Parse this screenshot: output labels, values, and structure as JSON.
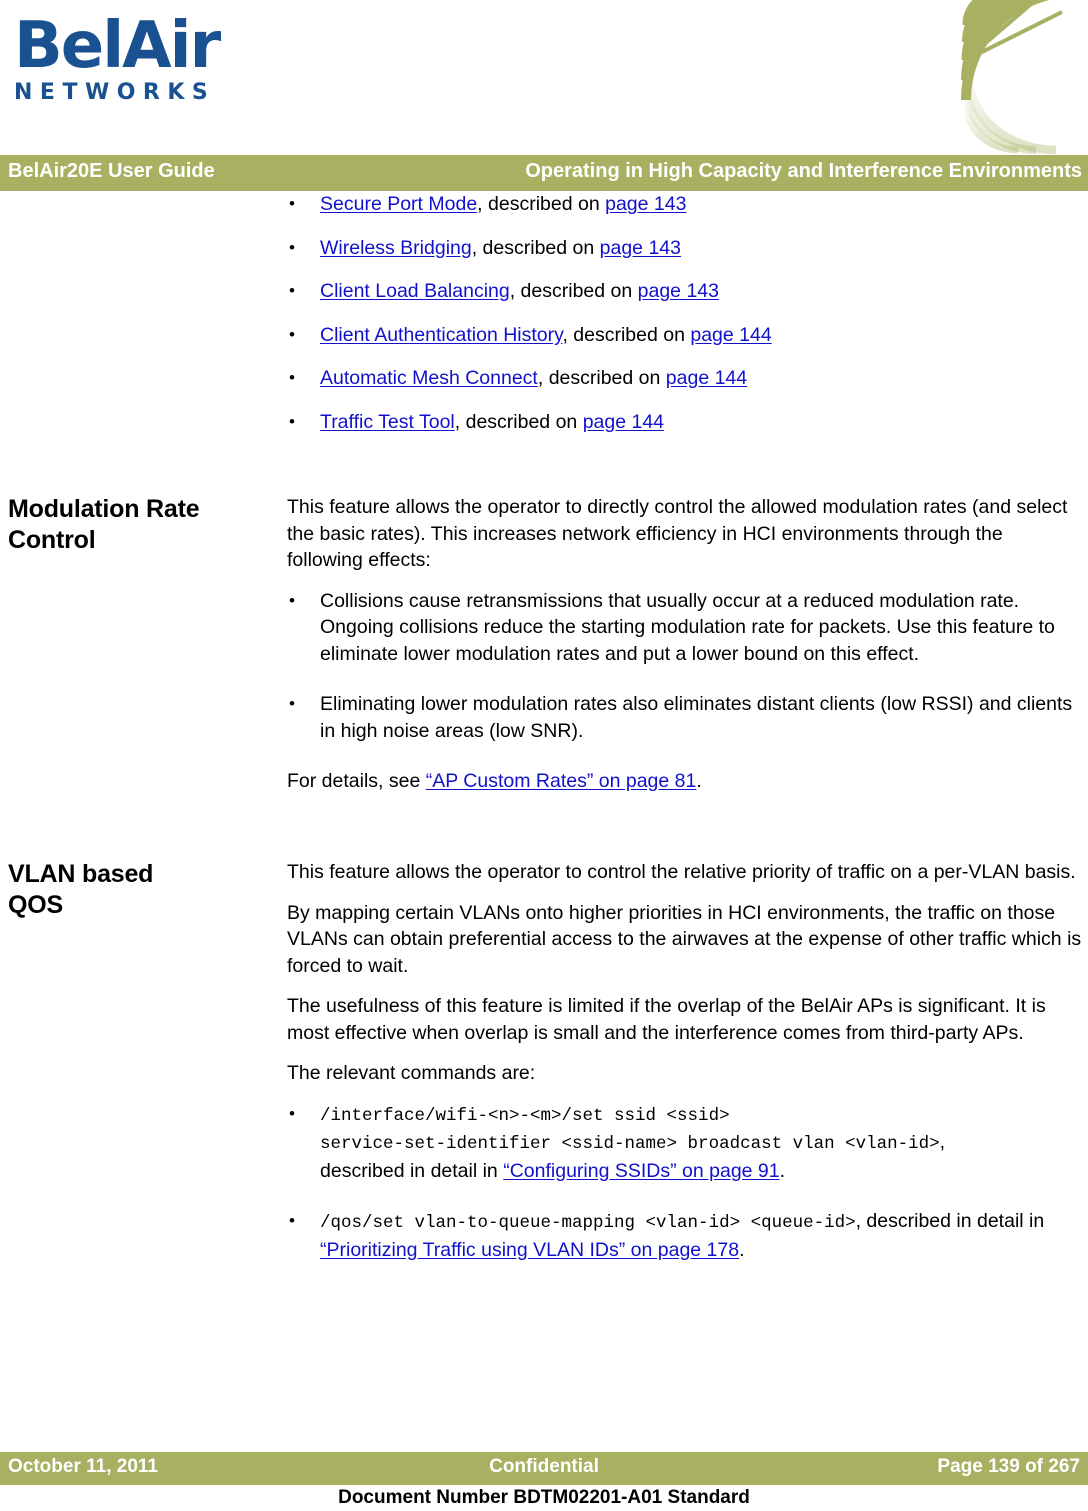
{
  "colors": {
    "brand_blue": "#1A5190",
    "bar_green": "#A8B162",
    "link_blue": "#1111CC",
    "text_black": "#000000"
  },
  "masthead": {
    "logo_word": "BelAir",
    "logo_sub": "NETWORKS"
  },
  "header": {
    "left": "BelAir20E User Guide",
    "right": "Operating in High Capacity and Interference Environments"
  },
  "feature_list": [
    {
      "link": "Secure Port Mode",
      "mid": ", described on ",
      "page": "page 143"
    },
    {
      "link": "Wireless Bridging",
      "mid": ", described on ",
      "page": "page 143"
    },
    {
      "link": "Client Load Balancing",
      "mid": ", described on ",
      "page": "page 143"
    },
    {
      "link": "Client Authentication History",
      "mid": ", described on ",
      "page": "page 144"
    },
    {
      "link": "Automatic Mesh Connect",
      "mid": ", described on ",
      "page": "page 144"
    },
    {
      "link": "Traffic Test Tool",
      "mid": ", described on ",
      "page": "page 144"
    }
  ],
  "section_modulation": {
    "heading_line1": "Modulation Rate",
    "heading_line2": "Control",
    "intro": "This feature allows the operator to directly control the allowed modulation rates (and select the basic rates). This increases network efficiency in HCI environments through the following effects:",
    "bullets": [
      "Collisions cause retransmissions that usually occur at a reduced modulation rate.  Ongoing collisions reduce the starting modulation rate for packets. Use this feature to eliminate lower modulation rates and put a lower bound on this effect.",
      "Eliminating lower modulation rates also eliminates distant clients (low RSSI) and clients in high noise areas (low SNR)."
    ],
    "details_prefix": "For details, see ",
    "details_link": "“AP Custom Rates” on page 81",
    "details_suffix": "."
  },
  "section_vlan": {
    "heading_line1": "VLAN based",
    "heading_line2": "QOS",
    "para1": "This feature allows the operator to control the relative priority of traffic on a per-VLAN basis.",
    "para2": "By mapping certain VLANs onto higher priorities in HCI environments, the traffic on those VLANs can obtain preferential access to the airwaves at the expense of other traffic which is forced to wait.",
    "para3": "The usefulness of this feature is limited if the overlap of the BelAir APs is significant. It is most effective when overlap is small and the interference comes from third-party APs.",
    "para4": "The relevant commands are:",
    "commands": [
      {
        "code_line1": "/interface/wifi-<n>-<m>/set ssid <ssid>",
        "code_line2": "service-set-identifier <ssid-name> broadcast vlan <vlan-id>",
        "after_code": ",",
        "tail_prefix": "described in detail in ",
        "tail_link": "“Configuring SSIDs” on page 91",
        "tail_suffix": "."
      },
      {
        "code_line1": "/qos/set vlan-to-queue-mapping <vlan-id> <queue-id>",
        "code_line2": "",
        "after_code": ",",
        "tail_prefix": " described in detail in ",
        "tail_link": "“Prioritizing Traffic using VLAN IDs” on page 178",
        "tail_suffix": "."
      }
    ]
  },
  "footer": {
    "date": "October 11, 2011",
    "classification": "Confidential",
    "page": "Page 139 of 267",
    "doc_number": "Document Number BDTM02201-A01 Standard"
  }
}
